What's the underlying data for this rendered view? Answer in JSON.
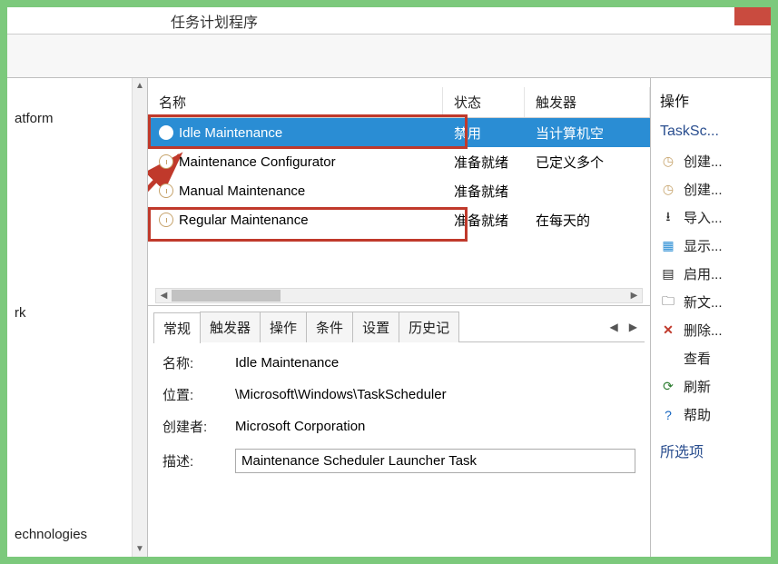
{
  "window": {
    "title": "任务计划程序"
  },
  "tree": {
    "items": [
      "atform",
      "rk",
      "echnologies"
    ]
  },
  "task_table": {
    "columns": {
      "name": "名称",
      "state": "状态",
      "trigger": "触发器"
    },
    "rows": [
      {
        "name": "Idle Maintenance",
        "state": "禁用",
        "trigger": "当计算机空"
      },
      {
        "name": "Maintenance Configurator",
        "state": "准备就绪",
        "trigger": "已定义多个"
      },
      {
        "name": "Manual Maintenance",
        "state": "准备就绪",
        "trigger": ""
      },
      {
        "name": "Regular Maintenance",
        "state": "准备就绪",
        "trigger": "在每天的"
      }
    ]
  },
  "tabs": {
    "items": [
      "常规",
      "触发器",
      "操作",
      "条件",
      "设置",
      "历史记"
    ]
  },
  "details": {
    "name_label": "名称:",
    "name_value": "Idle Maintenance",
    "location_label": "位置:",
    "location_value": "\\Microsoft\\Windows\\TaskScheduler",
    "author_label": "创建者:",
    "author_value": "Microsoft Corporation",
    "desc_label": "描述:",
    "desc_value": "Maintenance Scheduler Launcher Task"
  },
  "actions": {
    "header": "操作",
    "section": "TaskSc...",
    "items": [
      {
        "icon": "clock-icon",
        "label": "创建..."
      },
      {
        "icon": "clock-icon",
        "label": "创建..."
      },
      {
        "icon": "import-icon",
        "label": "导入..."
      },
      {
        "icon": "show-icon",
        "label": "显示..."
      },
      {
        "icon": "enable-icon",
        "label": "启用..."
      },
      {
        "icon": "newfolder-icon",
        "label": "新文..."
      },
      {
        "icon": "delete-icon",
        "label": "删除..."
      },
      {
        "icon": "view-icon",
        "label": "查看"
      },
      {
        "icon": "refresh-icon",
        "label": "刷新"
      },
      {
        "icon": "help-icon",
        "label": "帮助"
      }
    ],
    "selected_section": "所选项"
  }
}
